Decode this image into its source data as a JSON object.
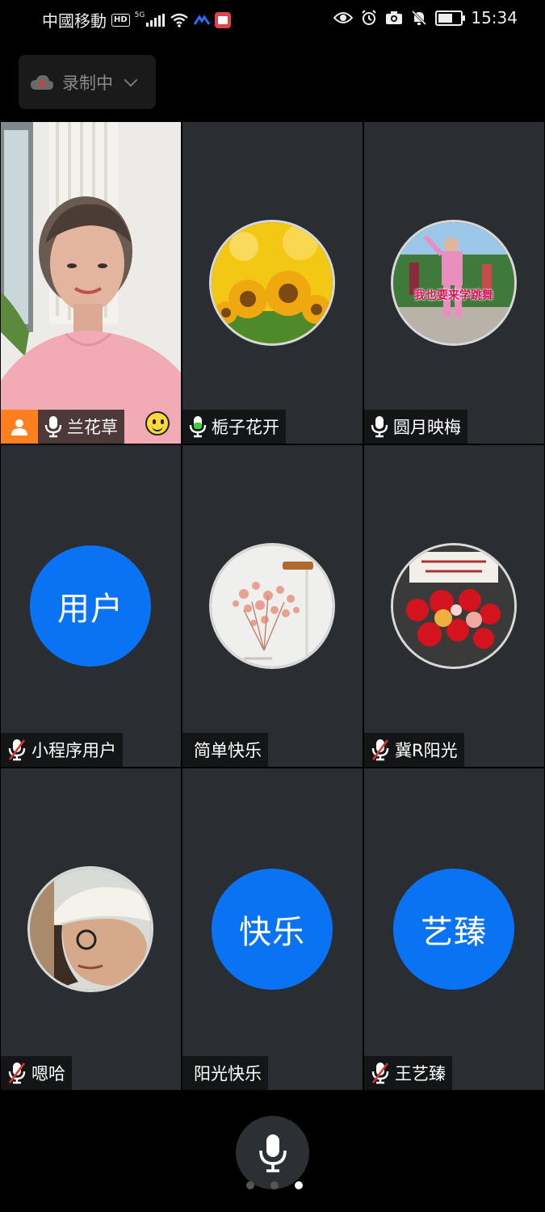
{
  "status_bar": {
    "carrier": "中國移動",
    "hd": "HD",
    "network": "5G",
    "time": "15:34"
  },
  "recording": {
    "label": "录制中"
  },
  "participants": [
    {
      "name": "兰花草",
      "mic": "on",
      "avatar": "video",
      "host": true
    },
    {
      "name": "栀子花开",
      "mic": "on",
      "avatar": "photo-sunflowers"
    },
    {
      "name": "圆月映梅",
      "mic": "on",
      "avatar": "photo-dance",
      "avatar_caption": "我也要来学跳舞"
    },
    {
      "name": "小程序用户",
      "mic": "muted",
      "avatar": "text",
      "avatar_text": "用户"
    },
    {
      "name": "简单快乐",
      "mic": "none",
      "avatar": "photo-flowers"
    },
    {
      "name": "冀R阳光",
      "mic": "muted",
      "avatar": "photo-roses"
    },
    {
      "name": "嗯哈",
      "mic": "muted",
      "avatar": "photo-cap"
    },
    {
      "name": "阳光快乐",
      "mic": "none",
      "avatar": "text",
      "avatar_text": "快乐"
    },
    {
      "name": "王艺臻",
      "mic": "muted",
      "avatar": "text",
      "avatar_text": "艺臻"
    }
  ],
  "colors": {
    "avatar_blue": "#0a73f4",
    "host_badge": "#ff7f1e",
    "tile_bg": "#2a2d31",
    "mic_on": "#ffffff",
    "mic_muted_slash": "#e03030"
  },
  "pager": {
    "pages": 3,
    "current": 3
  }
}
